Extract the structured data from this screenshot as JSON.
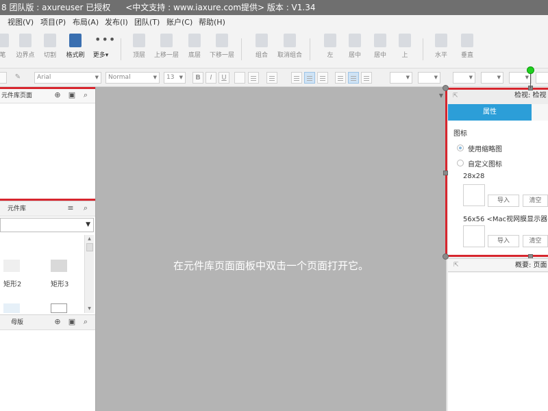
{
  "titlebar": {
    "part1": "8 团队版 : axureuser 已授权",
    "part2": "<中文支持 : www.iaxure.com提供> 版本 : V1.34"
  },
  "menu": [
    "视图(V)",
    "项目(P)",
    "布局(A)",
    "发布(I)",
    "团队(T)",
    "账户(C)",
    "帮助(H)"
  ],
  "toolbar": {
    "items": [
      "笔",
      "边界点",
      "切割",
      "格式刷",
      "更多▾",
      "顶层",
      "上移一层",
      "底层",
      "下移一层",
      "组合",
      "取消组合",
      "左",
      "居中",
      "居中",
      "上",
      "水平",
      "垂直"
    ]
  },
  "formatbar": {
    "font": "Arial",
    "style": "Normal",
    "size": "13",
    "bold": "B",
    "italic": "I",
    "underline": "U"
  },
  "left": {
    "pages_title": "元件库页面",
    "library_title": "元件库",
    "widgets": [
      "矩形2",
      "矩形3"
    ],
    "masters_title": "母版"
  },
  "canvas": {
    "message": "在元件库页面面板中双击一个页面打开它。"
  },
  "right": {
    "header": "检视: 检视",
    "tab_properties": "属性",
    "section_icon": "图标",
    "option_thumbnail": "使用缩略图",
    "option_custom": "自定义图标",
    "size_small": "28x28",
    "size_large": "56x56 <Mac视网膜显示器",
    "import_label": "导入",
    "clear_label": "清空",
    "overview": "概要: 页面"
  },
  "colors": {
    "accent": "#2c9ed8",
    "highlight_border": "#d7262e",
    "canvas_bg": "#b4b4b4",
    "rotate_handle": "#1fd01f"
  }
}
